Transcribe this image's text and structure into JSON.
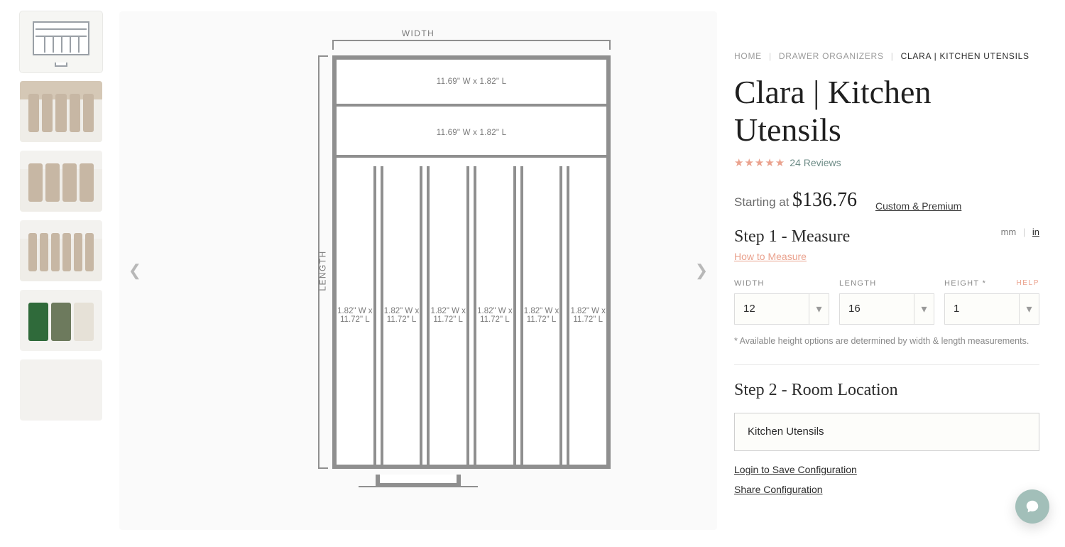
{
  "breadcrumbs": {
    "home": "HOME",
    "cat": "DRAWER ORGANIZERS",
    "current": "CLARA | KITCHEN UTENSILS"
  },
  "title": "Clara | Kitchen Utensils",
  "reviews": {
    "count_label": "24 Reviews"
  },
  "price": {
    "starting_label": "Starting at",
    "amount": "$136.76",
    "custom_link": "Custom & Premium"
  },
  "step1": {
    "heading": "Step 1 - Measure",
    "howto": "How to Measure",
    "units": {
      "mm": "mm",
      "in": "in",
      "active": "in"
    }
  },
  "fields": {
    "width": {
      "label": "WIDTH",
      "value": "12"
    },
    "length": {
      "label": "LENGTH",
      "value": "16"
    },
    "height": {
      "label": "HEIGHT *",
      "help": "HELP",
      "value": "1"
    }
  },
  "height_note": "* Available height options are determined by width & length measurements.",
  "step2": {
    "heading": "Step 2 - Room Location",
    "value": "Kitchen Utensils"
  },
  "links": {
    "login": "Login to Save Configuration",
    "share": "Share Configuration"
  },
  "diagram": {
    "width_label": "WIDTH",
    "length_label": "LENGTH",
    "rows": [
      "11.69\" W x 1.82\" L",
      "11.69\" W x 1.82\" L"
    ],
    "cols": [
      "1.82\" W x 11.72\" L",
      "1.82\" W x 11.72\" L",
      "1.82\" W x 11.72\" L",
      "1.82\" W x 11.72\" L",
      "1.82\" W x 11.72\" L",
      "1.82\" W x 11.72\" L"
    ]
  }
}
